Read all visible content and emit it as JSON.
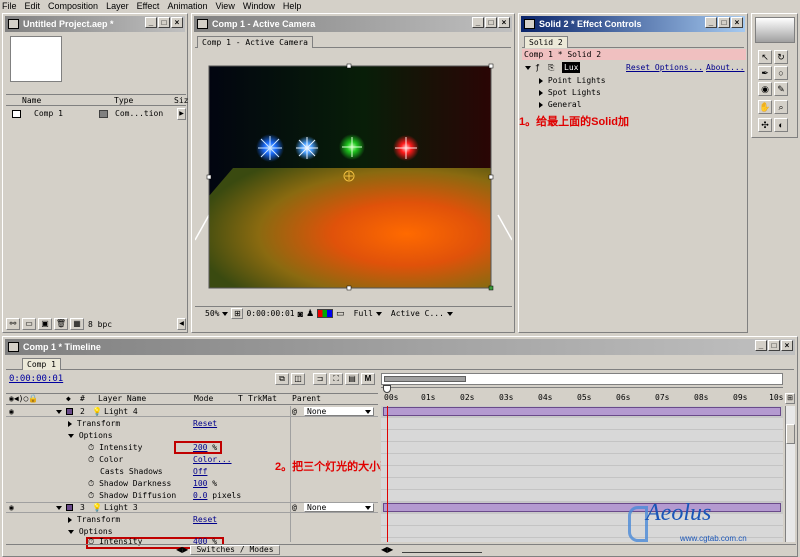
{
  "menu": [
    "File",
    "Edit",
    "Composition",
    "Layer",
    "Effect",
    "Animation",
    "View",
    "Window",
    "Help"
  ],
  "project": {
    "title": "Untitled Project.aep *",
    "columns": [
      "Name",
      "Type",
      "Siz"
    ],
    "item": {
      "name": "Comp 1",
      "type": "Com...tion"
    },
    "bpc": "8 bpc"
  },
  "comp": {
    "title": "Comp 1 - Active Camera",
    "tab": "Comp 1 - Active Camera",
    "zoom": "50%",
    "timecode": "0:00:00:01",
    "resolution": "Full",
    "camera": "Active C..."
  },
  "effects": {
    "title": "Solid 2 * Effect Controls",
    "tab": "Solid 2",
    "path": "Comp 1 * Solid 2",
    "effect": "Lux",
    "reset": "Reset Options...",
    "about": "About...",
    "groups": [
      "Point Lights",
      "Spot Lights",
      "General"
    ],
    "annotation": "1。给最上面的Solid加"
  },
  "timeline": {
    "title": "Comp 1 * Timeline",
    "tab": "Comp 1",
    "timecode": "0:00:00:01",
    "headers": {
      "num": "#",
      "layer": "Layer Name",
      "mode": "Mode",
      "t": "T",
      "trkmat": "TrkMat",
      "parent": "Parent"
    },
    "ruler": [
      "00s",
      "01s",
      "02s",
      "03s",
      "04s",
      "05s",
      "06s",
      "07s",
      "08s",
      "09s",
      "10s"
    ],
    "layers": [
      {
        "num": "2",
        "name": "Light 4",
        "parent": "None"
      },
      {
        "num": "3",
        "name": "Light 3",
        "parent": "None"
      }
    ],
    "props": {
      "transform": "Transform",
      "options": "Options",
      "intensity": "Intensity",
      "color": "Color",
      "casts": "Casts Shadows",
      "darkness": "Shadow Darkness",
      "diffusion": "Shadow Diffusion",
      "reset": "Reset"
    },
    "values1": {
      "intensity": "200",
      "intensity_unit": "%",
      "color": "Color...",
      "casts": "Off",
      "darkness": "100",
      "darkness_unit": "%",
      "diffusion": "0.0",
      "diffusion_unit": "pixels"
    },
    "values2": {
      "intensity": "400",
      "intensity_unit": "%"
    },
    "switches": "Switches / Modes",
    "annotation": "2。把三个灯光的大小改成不同。"
  },
  "watermark": {
    "brand": "Aeolus",
    "site": "www.cgtab.com.cn"
  }
}
